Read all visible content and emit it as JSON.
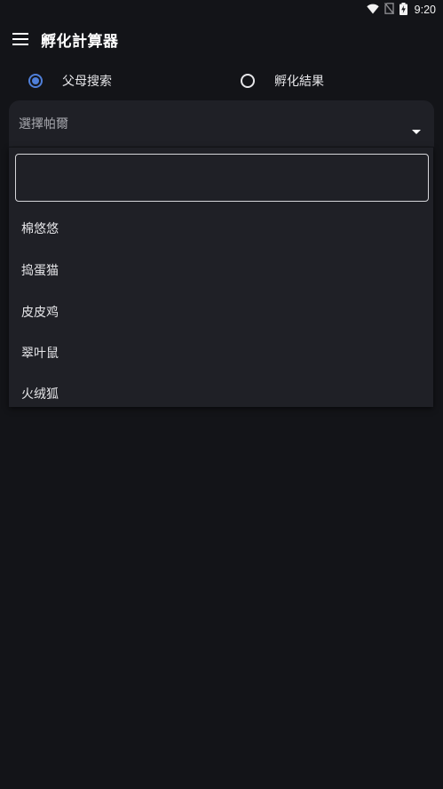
{
  "status_bar": {
    "time": "9:20"
  },
  "app_bar": {
    "title": "孵化計算器",
    "menu_icon": "hamburger-menu-icon"
  },
  "mode": {
    "options": [
      {
        "label": "父母搜索",
        "selected": true
      },
      {
        "label": "孵化結果",
        "selected": false
      }
    ],
    "accent_color": "#4f7fd9"
  },
  "select": {
    "label": "選擇帕爾"
  },
  "dropdown": {
    "search_value": "",
    "options": [
      "棉悠悠",
      "捣蛋猫",
      "皮皮鸡",
      "翠叶鼠",
      "火绒狐"
    ]
  }
}
